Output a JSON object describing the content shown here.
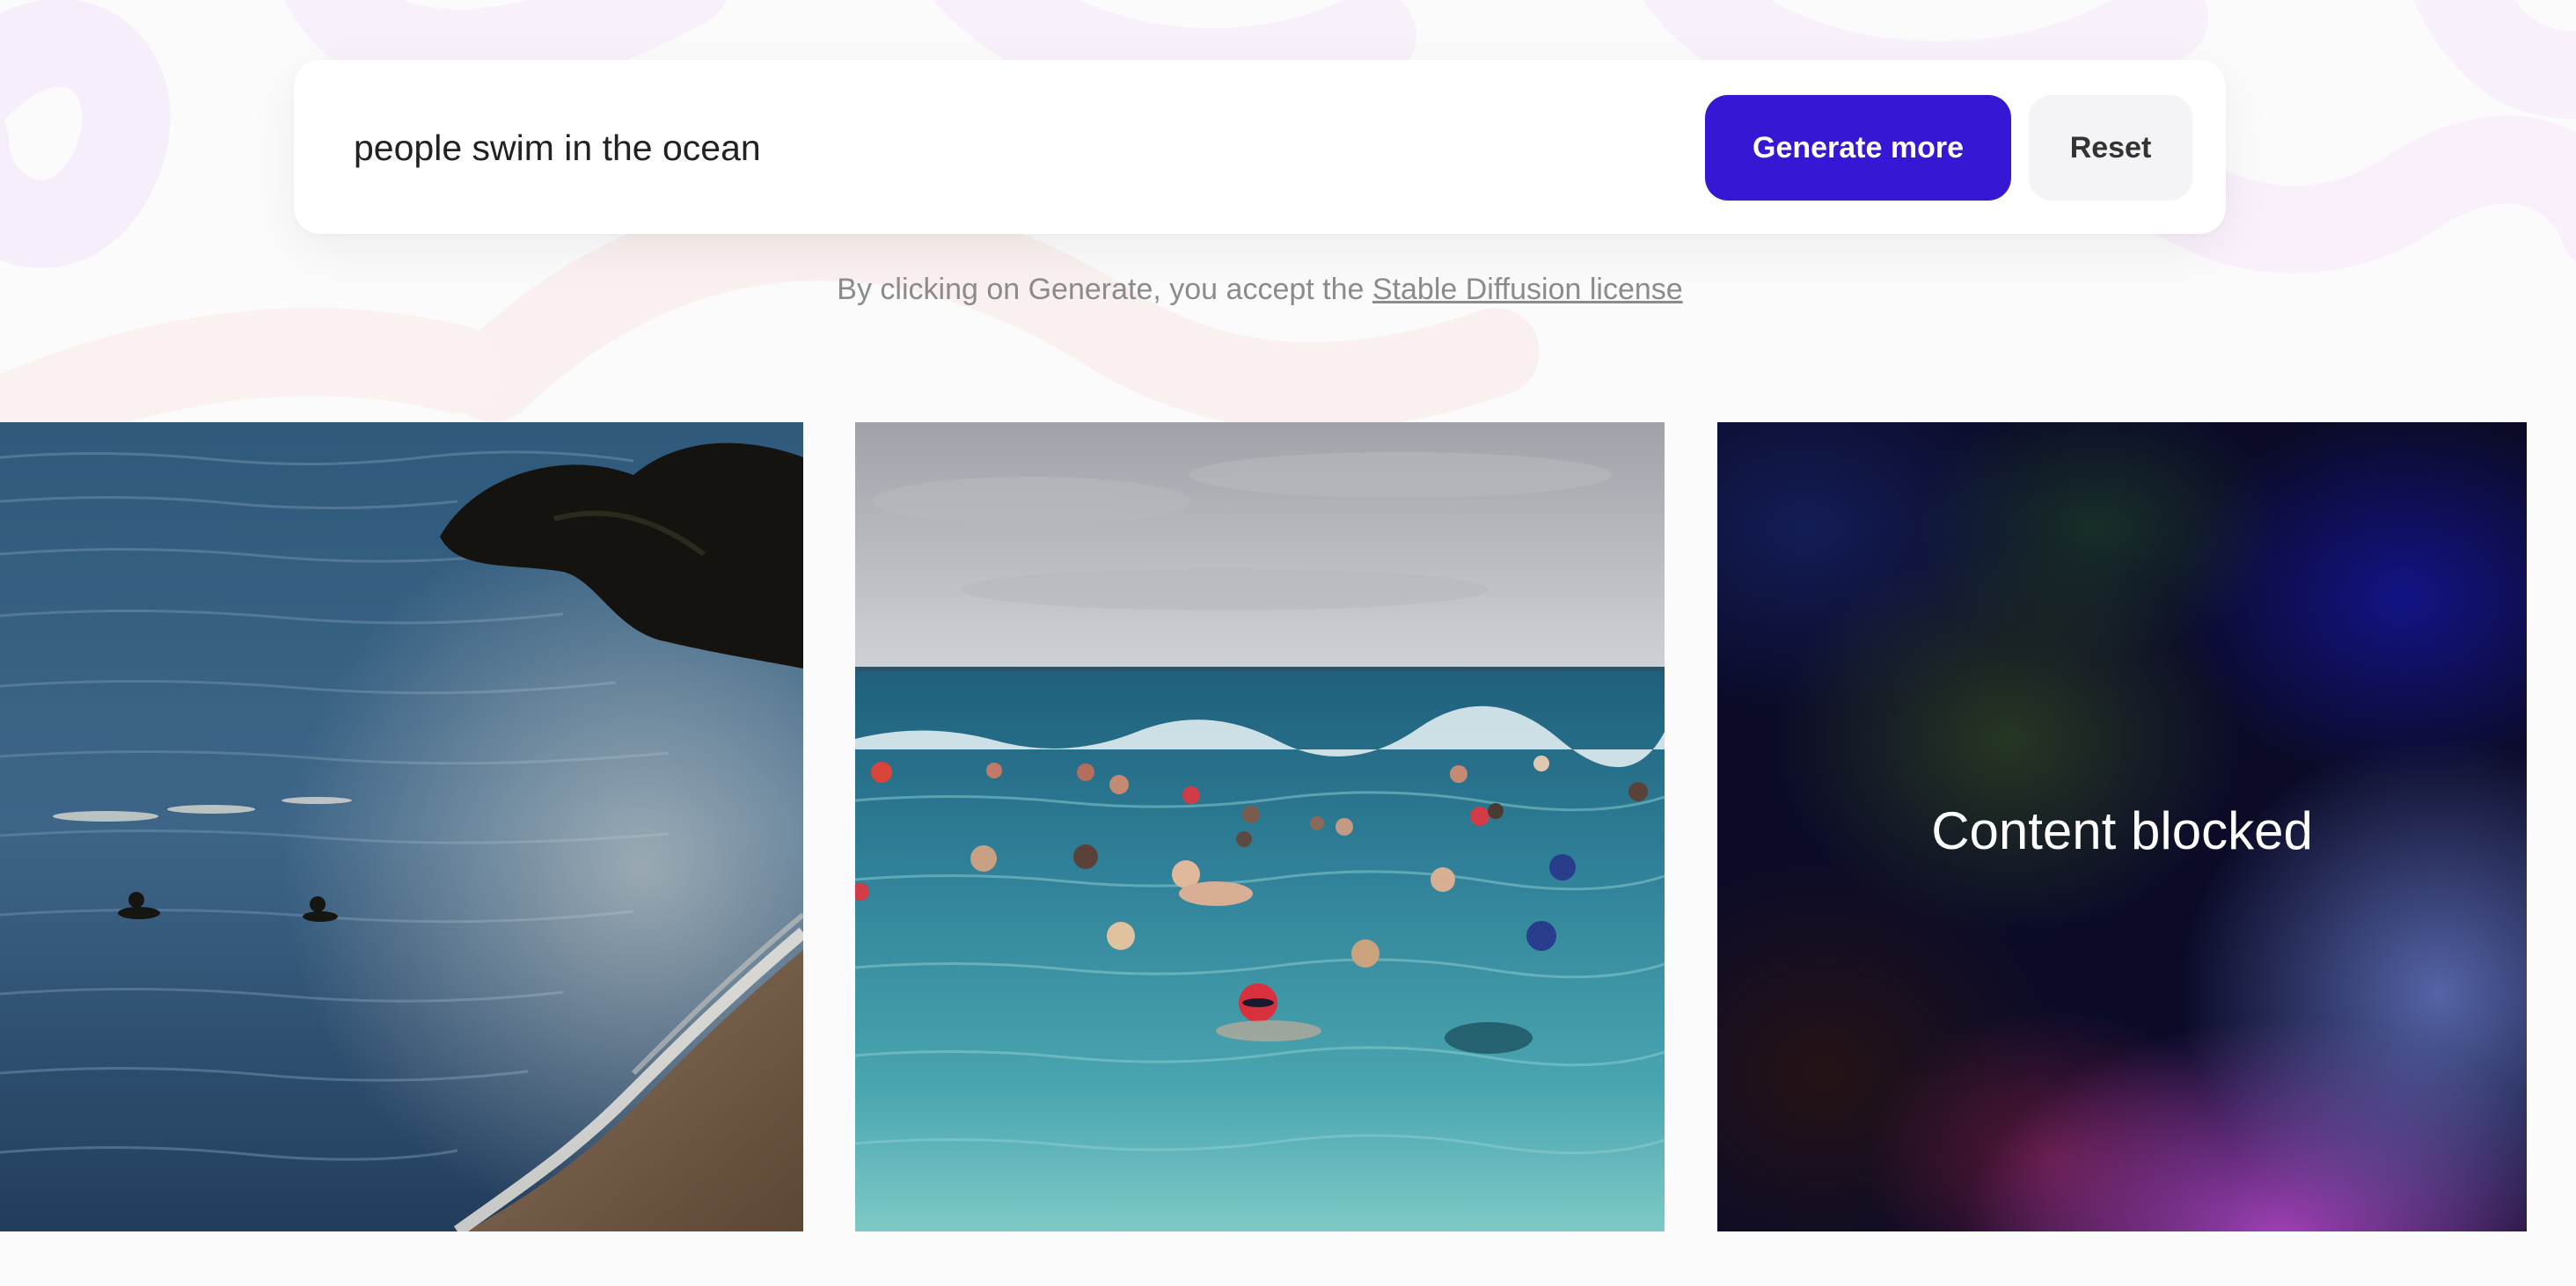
{
  "prompt": {
    "value": "people swim in the ocean",
    "generate_label": "Generate more",
    "reset_label": "Reset"
  },
  "license": {
    "prefix": "By clicking on Generate, you accept the ",
    "link_text": "Stable Diffusion license"
  },
  "results": [
    {
      "kind": "image",
      "subject": "two swimmers near a rocky shoreline at sunset"
    },
    {
      "kind": "image",
      "subject": "group of swimmers with caps in turquoise sea"
    },
    {
      "kind": "blocked",
      "label": "Content blocked"
    }
  ],
  "colors": {
    "accent": "#3617d4",
    "reset_bg": "#f4f4f6",
    "muted_text": "#8b8b8b"
  }
}
